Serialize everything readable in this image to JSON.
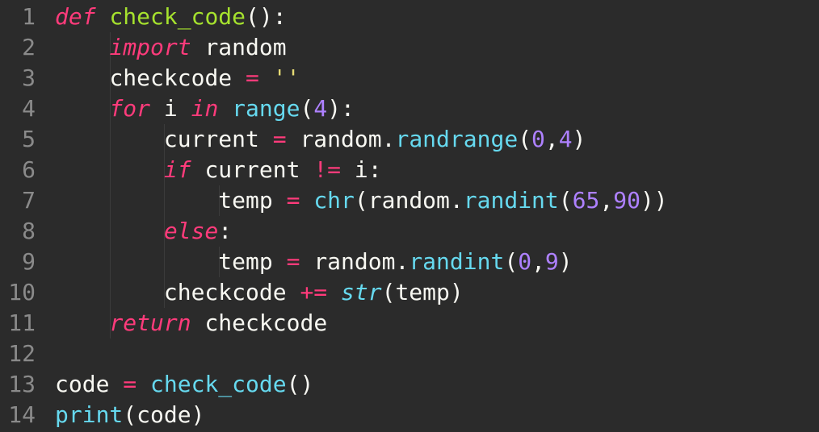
{
  "editor": {
    "line_numbers": [
      "1",
      "2",
      "3",
      "4",
      "5",
      "6",
      "7",
      "8",
      "9",
      "10",
      "11",
      "12",
      "13",
      "14"
    ],
    "colors": {
      "background": "#2b2b2b",
      "gutter_fg": "#8a8a8a",
      "default_fg": "#f8f8f2",
      "keyword": "#ff3b7b",
      "func_def": "#a6e22e",
      "builtin_call": "#66d9ef",
      "number": "#ae81ff",
      "string": "#e6db74"
    },
    "lines": [
      [
        {
          "cls": "kw",
          "t": "def"
        },
        {
          "cls": "pun",
          "t": " "
        },
        {
          "cls": "fn",
          "t": "check_code"
        },
        {
          "cls": "pun",
          "t": "():"
        }
      ],
      [
        {
          "cls": "pun",
          "t": "    "
        },
        {
          "cls": "kw",
          "t": "import"
        },
        {
          "cls": "pun",
          "t": " "
        },
        {
          "cls": "id",
          "t": "random"
        }
      ],
      [
        {
          "cls": "pun",
          "t": "    "
        },
        {
          "cls": "id",
          "t": "checkcode"
        },
        {
          "cls": "pun",
          "t": " "
        },
        {
          "cls": "op",
          "t": "="
        },
        {
          "cls": "pun",
          "t": " "
        },
        {
          "cls": "str",
          "t": "''"
        }
      ],
      [
        {
          "cls": "pun",
          "t": "    "
        },
        {
          "cls": "kw",
          "t": "for"
        },
        {
          "cls": "pun",
          "t": " "
        },
        {
          "cls": "id",
          "t": "i"
        },
        {
          "cls": "pun",
          "t": " "
        },
        {
          "cls": "kw",
          "t": "in"
        },
        {
          "cls": "pun",
          "t": " "
        },
        {
          "cls": "call",
          "t": "range"
        },
        {
          "cls": "pun",
          "t": "("
        },
        {
          "cls": "num",
          "t": "4"
        },
        {
          "cls": "pun",
          "t": "):"
        }
      ],
      [
        {
          "cls": "pun",
          "t": "        "
        },
        {
          "cls": "id",
          "t": "current"
        },
        {
          "cls": "pun",
          "t": " "
        },
        {
          "cls": "op",
          "t": "="
        },
        {
          "cls": "pun",
          "t": " "
        },
        {
          "cls": "id",
          "t": "random"
        },
        {
          "cls": "pun",
          "t": "."
        },
        {
          "cls": "call",
          "t": "randrange"
        },
        {
          "cls": "pun",
          "t": "("
        },
        {
          "cls": "num",
          "t": "0"
        },
        {
          "cls": "pun",
          "t": ","
        },
        {
          "cls": "num",
          "t": "4"
        },
        {
          "cls": "pun",
          "t": ")"
        }
      ],
      [
        {
          "cls": "pun",
          "t": "        "
        },
        {
          "cls": "kw",
          "t": "if"
        },
        {
          "cls": "pun",
          "t": " "
        },
        {
          "cls": "id",
          "t": "current"
        },
        {
          "cls": "pun",
          "t": " "
        },
        {
          "cls": "op",
          "t": "!="
        },
        {
          "cls": "pun",
          "t": " "
        },
        {
          "cls": "id",
          "t": "i"
        },
        {
          "cls": "pun",
          "t": ":"
        }
      ],
      [
        {
          "cls": "pun",
          "t": "            "
        },
        {
          "cls": "id",
          "t": "temp"
        },
        {
          "cls": "pun",
          "t": " "
        },
        {
          "cls": "op",
          "t": "="
        },
        {
          "cls": "pun",
          "t": " "
        },
        {
          "cls": "call",
          "t": "chr"
        },
        {
          "cls": "pun",
          "t": "("
        },
        {
          "cls": "id",
          "t": "random"
        },
        {
          "cls": "pun",
          "t": "."
        },
        {
          "cls": "call",
          "t": "randint"
        },
        {
          "cls": "pun",
          "t": "("
        },
        {
          "cls": "num",
          "t": "65"
        },
        {
          "cls": "pun",
          "t": ","
        },
        {
          "cls": "num",
          "t": "90"
        },
        {
          "cls": "pun",
          "t": "))"
        }
      ],
      [
        {
          "cls": "pun",
          "t": "        "
        },
        {
          "cls": "kw",
          "t": "else"
        },
        {
          "cls": "pun",
          "t": ":"
        }
      ],
      [
        {
          "cls": "pun",
          "t": "            "
        },
        {
          "cls": "id",
          "t": "temp"
        },
        {
          "cls": "pun",
          "t": " "
        },
        {
          "cls": "op",
          "t": "="
        },
        {
          "cls": "pun",
          "t": " "
        },
        {
          "cls": "id",
          "t": "random"
        },
        {
          "cls": "pun",
          "t": "."
        },
        {
          "cls": "call",
          "t": "randint"
        },
        {
          "cls": "pun",
          "t": "("
        },
        {
          "cls": "num",
          "t": "0"
        },
        {
          "cls": "pun",
          "t": ","
        },
        {
          "cls": "num",
          "t": "9"
        },
        {
          "cls": "pun",
          "t": ")"
        }
      ],
      [
        {
          "cls": "pun",
          "t": "        "
        },
        {
          "cls": "id",
          "t": "checkcode"
        },
        {
          "cls": "pun",
          "t": " "
        },
        {
          "cls": "op",
          "t": "+="
        },
        {
          "cls": "pun",
          "t": " "
        },
        {
          "cls": "calli",
          "t": "str"
        },
        {
          "cls": "pun",
          "t": "("
        },
        {
          "cls": "id",
          "t": "temp"
        },
        {
          "cls": "pun",
          "t": ")"
        }
      ],
      [
        {
          "cls": "pun",
          "t": "    "
        },
        {
          "cls": "kw",
          "t": "return"
        },
        {
          "cls": "pun",
          "t": " "
        },
        {
          "cls": "id",
          "t": "checkcode"
        }
      ],
      [],
      [
        {
          "cls": "id",
          "t": "code"
        },
        {
          "cls": "pun",
          "t": " "
        },
        {
          "cls": "op",
          "t": "="
        },
        {
          "cls": "pun",
          "t": " "
        },
        {
          "cls": "call",
          "t": "check_code"
        },
        {
          "cls": "pun",
          "t": "()"
        }
      ],
      [
        {
          "cls": "call",
          "t": "print"
        },
        {
          "cls": "pun",
          "t": "("
        },
        {
          "cls": "id",
          "t": "code"
        },
        {
          "cls": "pun",
          "t": ")"
        }
      ]
    ],
    "indent_guides": [
      [],
      [
        1
      ],
      [
        1
      ],
      [
        1
      ],
      [
        1,
        2
      ],
      [
        1,
        2
      ],
      [
        1,
        2,
        3
      ],
      [
        1,
        2
      ],
      [
        1,
        2,
        3
      ],
      [
        1,
        2
      ],
      [
        1
      ],
      [],
      [],
      []
    ]
  }
}
